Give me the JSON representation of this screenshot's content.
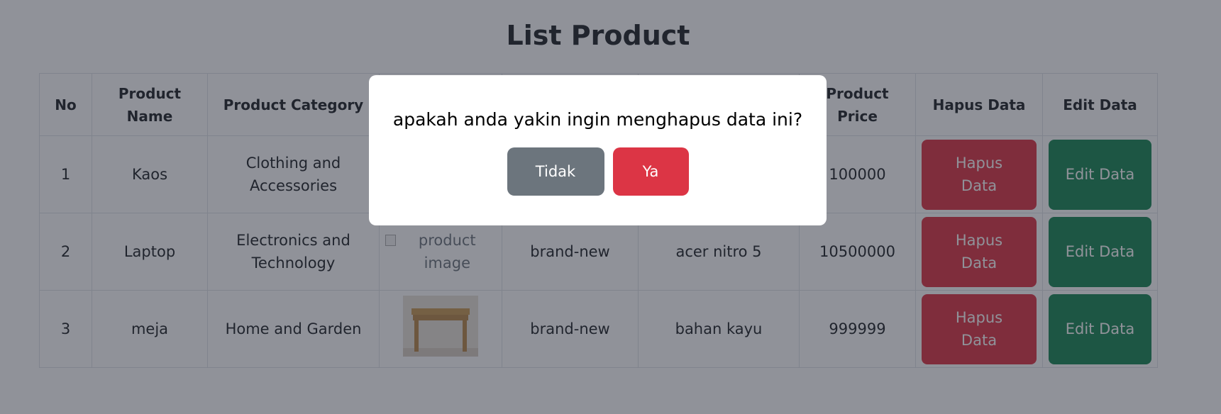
{
  "page": {
    "title": "List Product"
  },
  "table": {
    "headers": [
      "No",
      "Product Name",
      "Product Category",
      "",
      "",
      "",
      "Product Price",
      "Hapus Data",
      "Edit Data"
    ],
    "rows": [
      {
        "no": "1",
        "name": "Kaos",
        "category": "Clothing and Accessories",
        "image_alt": "",
        "condition": "",
        "description": "",
        "price": "100000",
        "hapus_label": "Hapus Data",
        "edit_label": "Edit Data"
      },
      {
        "no": "2",
        "name": "Laptop",
        "category": "Electronics and Technology",
        "image_alt": "product image",
        "condition": "brand-new",
        "description": "acer nitro 5",
        "price": "10500000",
        "hapus_label": "Hapus Data",
        "edit_label": "Edit Data"
      },
      {
        "no": "3",
        "name": "meja",
        "category": "Home and Garden",
        "image_alt": "",
        "condition": "brand-new",
        "description": "bahan kayu",
        "price": "999999",
        "hapus_label": "Hapus Data",
        "edit_label": "Edit Data"
      }
    ]
  },
  "modal": {
    "message": "apakah anda yakin ingin menghapus data ini?",
    "cancel_label": "Tidak",
    "confirm_label": "Ya"
  },
  "colors": {
    "danger": "#dc3545",
    "success": "#198754",
    "secondary": "#6c757d",
    "backdrop": "rgba(33,37,52,0.5)"
  }
}
